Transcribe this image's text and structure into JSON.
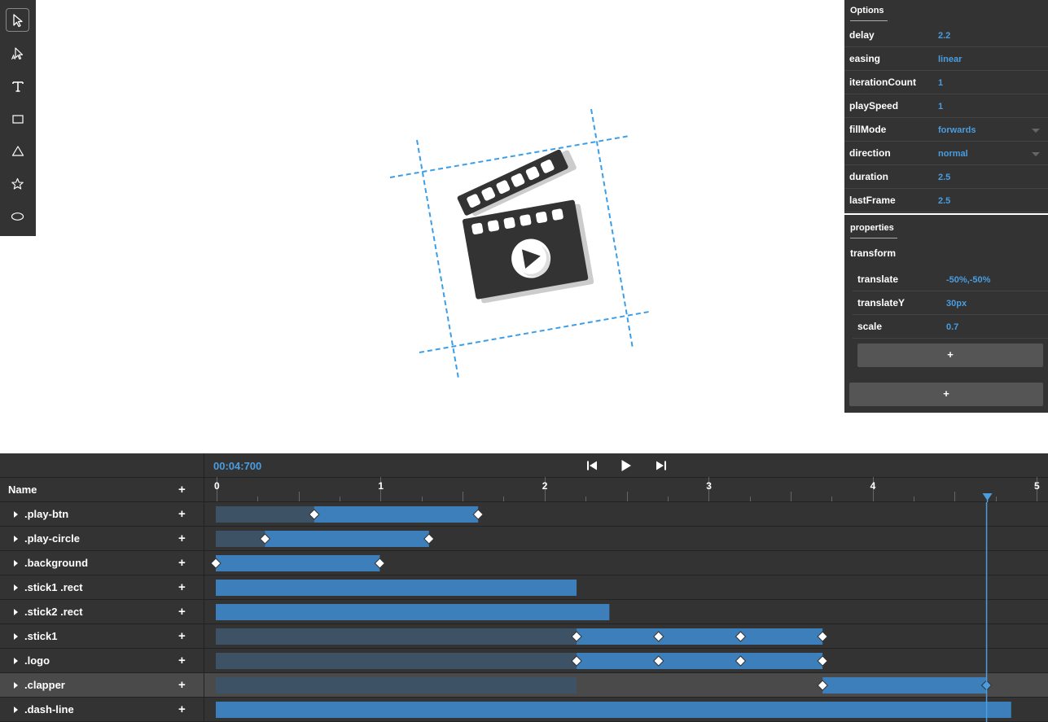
{
  "toolbar": {
    "tools": [
      {
        "icon": "selector-icon",
        "active": true
      },
      {
        "icon": "direct-selector-icon",
        "active": false
      },
      {
        "icon": "text-tool-icon",
        "active": false
      },
      {
        "icon": "rectangle-tool-icon",
        "active": false
      },
      {
        "icon": "triangle-tool-icon",
        "active": false
      },
      {
        "icon": "star-tool-icon",
        "active": false
      },
      {
        "icon": "ellipse-tool-icon",
        "active": false
      }
    ]
  },
  "options": {
    "title": "Options",
    "rows": [
      {
        "label": "delay",
        "value": "2.2",
        "dropdown": false
      },
      {
        "label": "easing",
        "value": "linear",
        "dropdown": false
      },
      {
        "label": "iterationCount",
        "value": "1",
        "dropdown": false
      },
      {
        "label": "playSpeed",
        "value": "1",
        "dropdown": false
      },
      {
        "label": "fillMode",
        "value": "forwards",
        "dropdown": true
      },
      {
        "label": "direction",
        "value": "normal",
        "dropdown": true
      },
      {
        "label": "duration",
        "value": "2.5",
        "dropdown": false
      },
      {
        "label": "lastFrame",
        "value": "2.5",
        "dropdown": false
      }
    ]
  },
  "properties": {
    "title": "properties",
    "group": "transform",
    "rows": [
      {
        "label": "translate",
        "value": "-50%,-50%"
      },
      {
        "label": "translateY",
        "value": "30px"
      },
      {
        "label": "scale",
        "value": "0.7"
      }
    ],
    "add_inner_label": "+",
    "add_outer_label": "+"
  },
  "timeline": {
    "time": "00:04:700",
    "name_header": "Name",
    "add_label": "+",
    "ticks": [
      "0",
      "1",
      "2",
      "3",
      "4",
      "5"
    ],
    "max_time": 5,
    "current_time": 4.7,
    "accent": "#4a9de0",
    "bar_color": "#3d7fba",
    "dim_color": "#3e5266",
    "rows": [
      {
        "name": ".play-btn",
        "selected": false,
        "dim_start": 0,
        "bar_start": 0.6,
        "bar_end": 1.6,
        "keyframes": [
          0.6,
          1.6
        ]
      },
      {
        "name": ".play-circle",
        "selected": false,
        "dim_start": 0,
        "bar_start": 0.3,
        "bar_end": 1.3,
        "keyframes": [
          0.3,
          1.3
        ]
      },
      {
        "name": ".background",
        "selected": false,
        "dim_start": 0,
        "bar_start": 0,
        "bar_end": 1.0,
        "keyframes": [
          0,
          1.0
        ]
      },
      {
        "name": ".stick1 .rect",
        "selected": false,
        "dim_start": 0,
        "bar_start": 0,
        "bar_end": 2.2,
        "keyframes": []
      },
      {
        "name": ".stick2 .rect",
        "selected": false,
        "dim_start": 0,
        "bar_start": 0,
        "bar_end": 2.4,
        "keyframes": []
      },
      {
        "name": ".stick1",
        "selected": false,
        "dim_start": 0,
        "bar_start": 2.2,
        "bar_end": 3.7,
        "keyframes": [
          2.2,
          2.7,
          3.2,
          3.7
        ]
      },
      {
        "name": ".logo",
        "selected": false,
        "dim_start": 0,
        "bar_start": 2.2,
        "bar_end": 3.7,
        "keyframes": [
          2.2,
          2.7,
          3.2,
          3.7
        ]
      },
      {
        "name": ".clapper",
        "selected": true,
        "dim_start": 0,
        "dim_end": 2.2,
        "bar_start": 3.7,
        "bar_end": 4.7,
        "keyframes": [
          3.7,
          4.7
        ]
      },
      {
        "name": ".dash-line",
        "selected": false,
        "dim_start": 0,
        "bar_start": 0,
        "bar_end": 4.85,
        "keyframes": []
      }
    ]
  }
}
